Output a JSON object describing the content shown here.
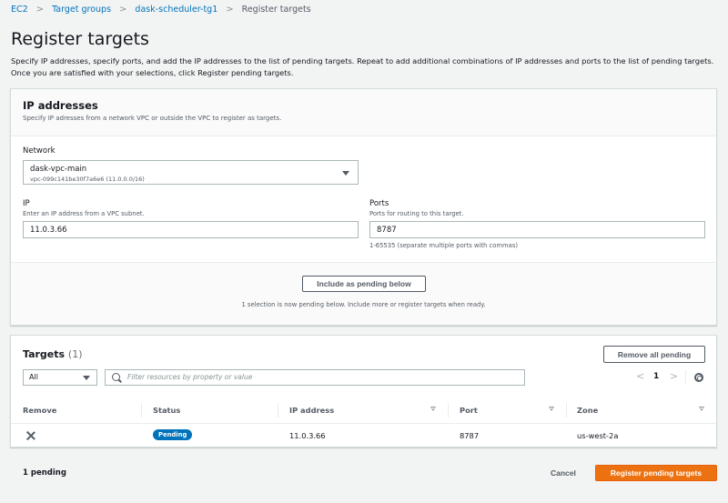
{
  "breadcrumb": {
    "items": [
      {
        "label": "EC2",
        "link": true
      },
      {
        "label": "Target groups",
        "link": true
      },
      {
        "label": "dask-scheduler-tg1",
        "link": true
      },
      {
        "label": "Register targets",
        "link": false
      }
    ],
    "separator": ">"
  },
  "page": {
    "title": "Register targets",
    "description": "Specify IP addresses, specify ports, and add the IP addresses to the list of pending targets. Repeat to add additional combinations of IP addresses and ports to the list of pending targets. Once you are satisfied with your selections, click Register pending targets."
  },
  "ip_section": {
    "title": "IP addresses",
    "subtitle": "Specify IP adresses from a network VPC or outside the VPC to register as targets.",
    "network": {
      "label": "Network",
      "selected_name": "dask-vpc-main",
      "selected_detail": "vpc-099c141be30f7a6e6 (11.0.0.0/16)"
    },
    "ip": {
      "label": "IP",
      "hint": "Enter an IP address from a VPC subnet.",
      "value": "11.0.3.66"
    },
    "ports": {
      "label": "Ports",
      "hint": "Ports for routing to this target.",
      "value": "8787",
      "constraint": "1-65535 (separate multiple ports with commas)"
    },
    "include_button": "Include as pending below",
    "pending_message": "1 selection is now pending below. Include more or register targets when ready."
  },
  "targets": {
    "title": "Targets",
    "count": "(1)",
    "remove_all_button": "Remove all pending",
    "filter_select": "All",
    "filter_placeholder": "Filter resources by property or value",
    "pagination": {
      "prev": "<",
      "page": "1",
      "next": ">"
    },
    "columns": [
      "Remove",
      "Status",
      "IP address",
      "Port",
      "Zone"
    ],
    "rows": [
      {
        "status": "Pending",
        "ip": "11.0.3.66",
        "port": "8787",
        "zone": "us-west-2a"
      }
    ]
  },
  "footer": {
    "pending_count": "1 pending",
    "cancel": "Cancel",
    "register": "Register pending targets"
  },
  "colors": {
    "link": "#0073bb",
    "primary": "#ec7211",
    "badge": "#0073bb"
  }
}
